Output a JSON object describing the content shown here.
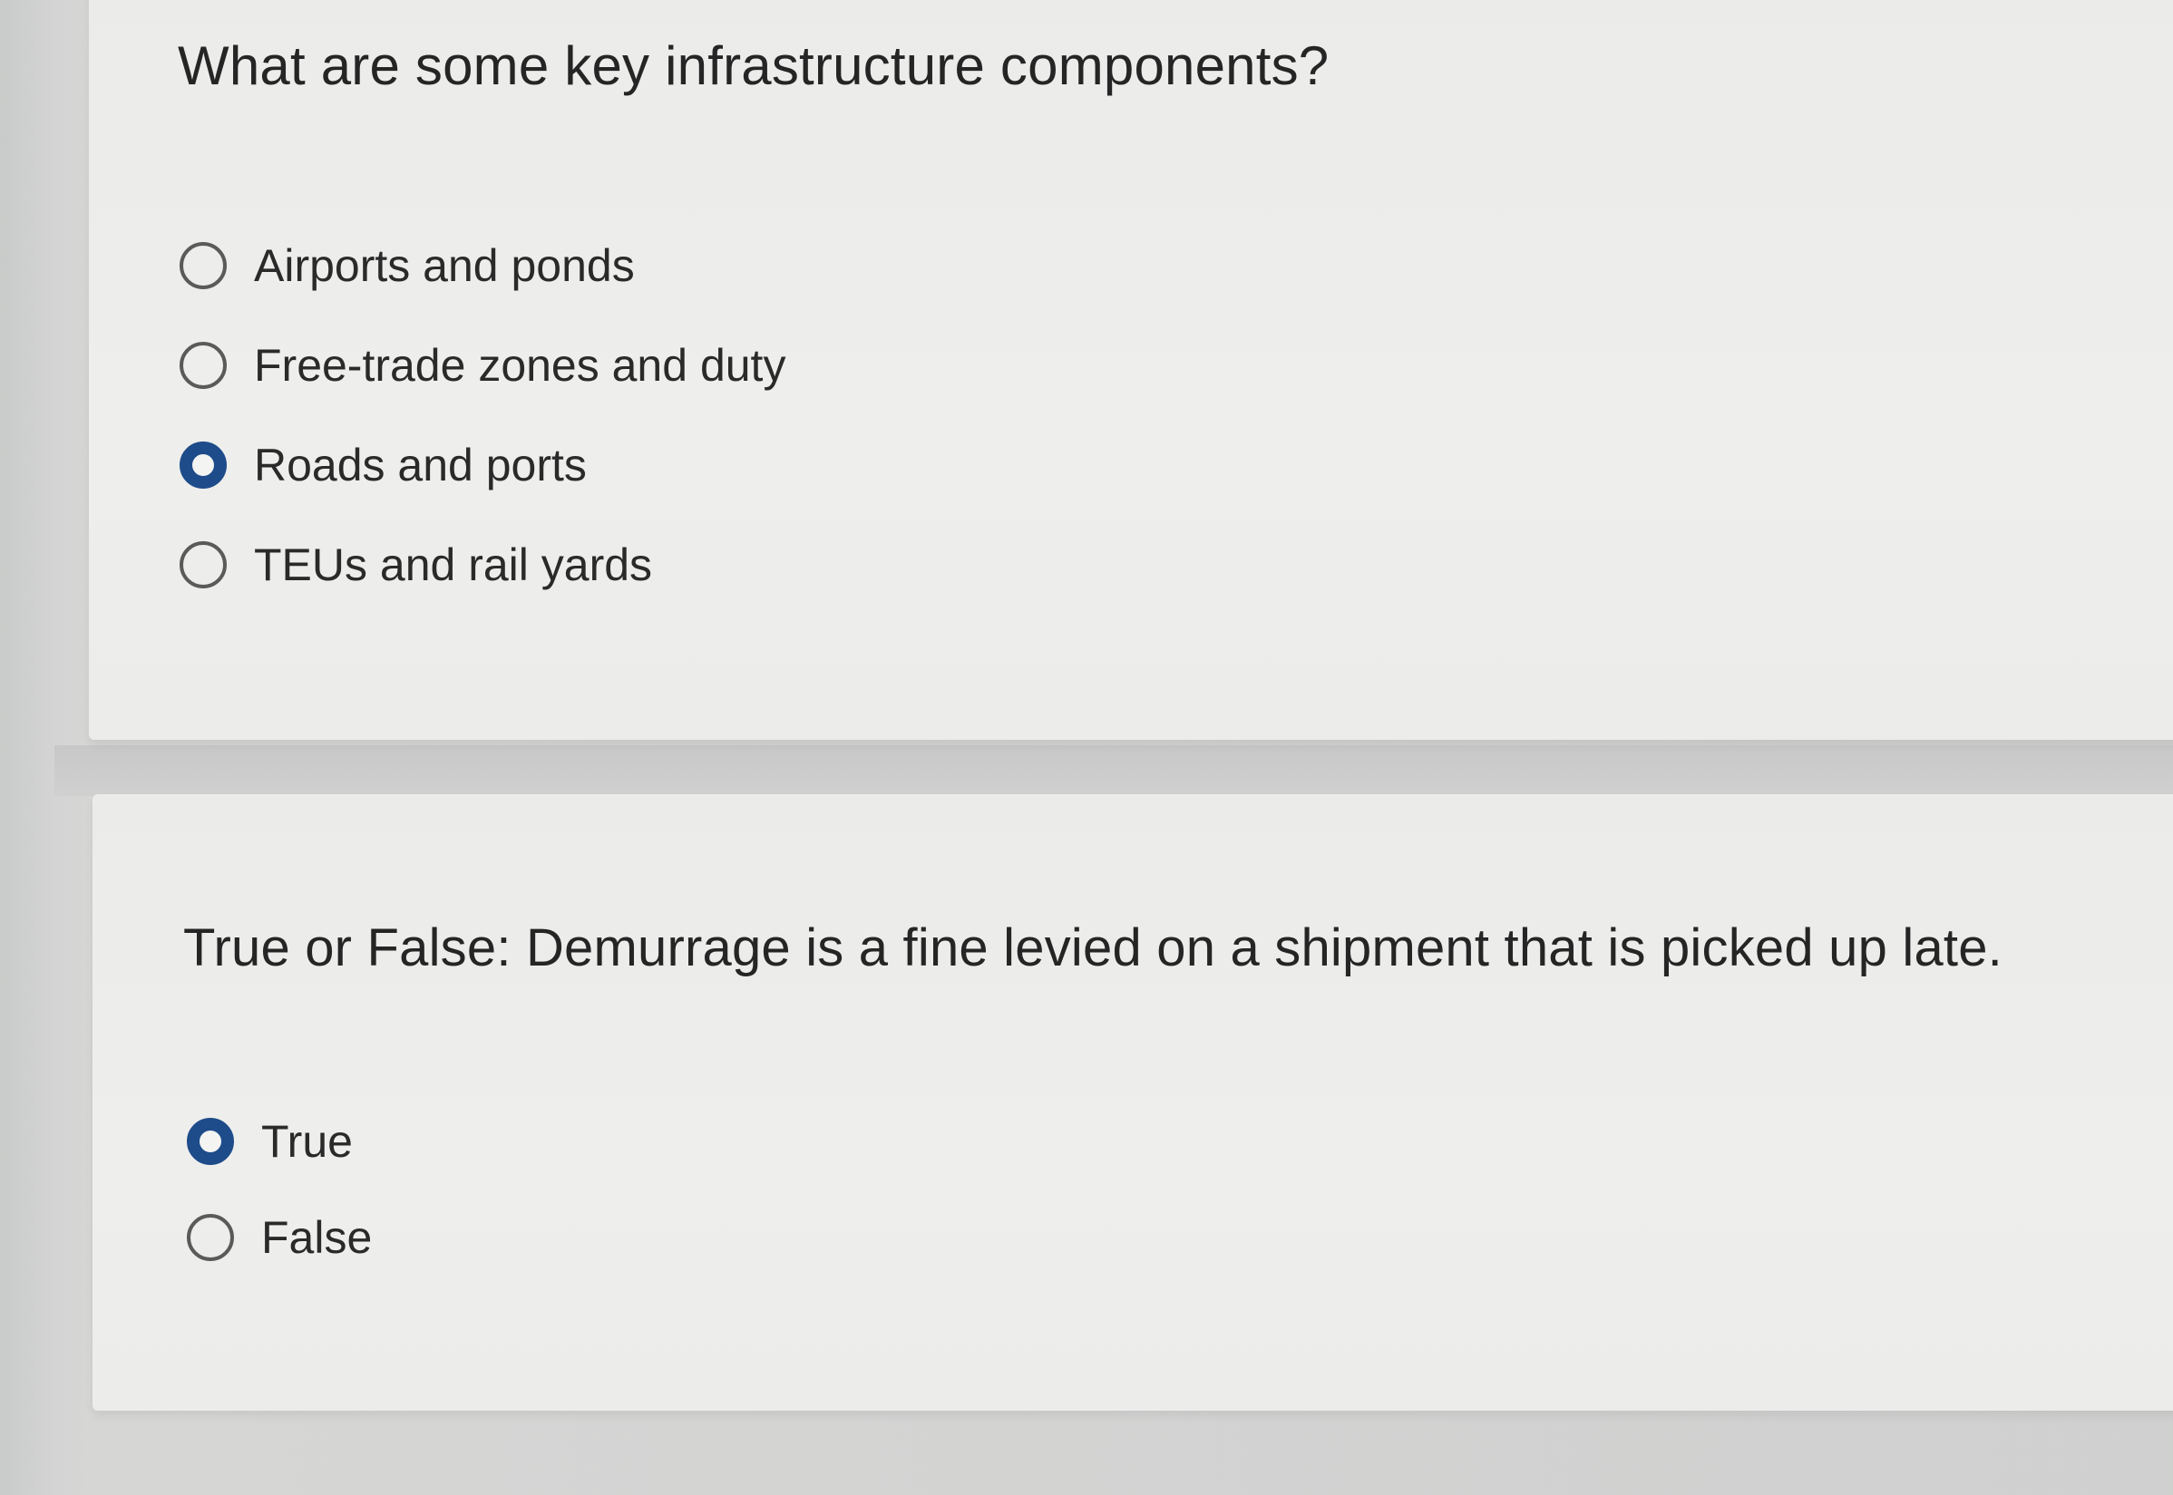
{
  "questions": [
    {
      "title": "What are some key infrastructure components?",
      "options": [
        {
          "label": "Airports and ponds",
          "selected": false
        },
        {
          "label": "Free-trade zones and duty",
          "selected": false
        },
        {
          "label": "Roads and ports",
          "selected": true
        },
        {
          "label": "TEUs and rail yards",
          "selected": false
        }
      ]
    },
    {
      "title": "True or False: Demurrage is a fine levied on a shipment that is picked up late.",
      "options": [
        {
          "label": "True",
          "selected": true
        },
        {
          "label": "False",
          "selected": false
        }
      ]
    }
  ],
  "colors": {
    "accent": "#1e4c8a",
    "card_background": "#eeeeec",
    "page_background": "#d3d4d3",
    "text": "#262626"
  }
}
